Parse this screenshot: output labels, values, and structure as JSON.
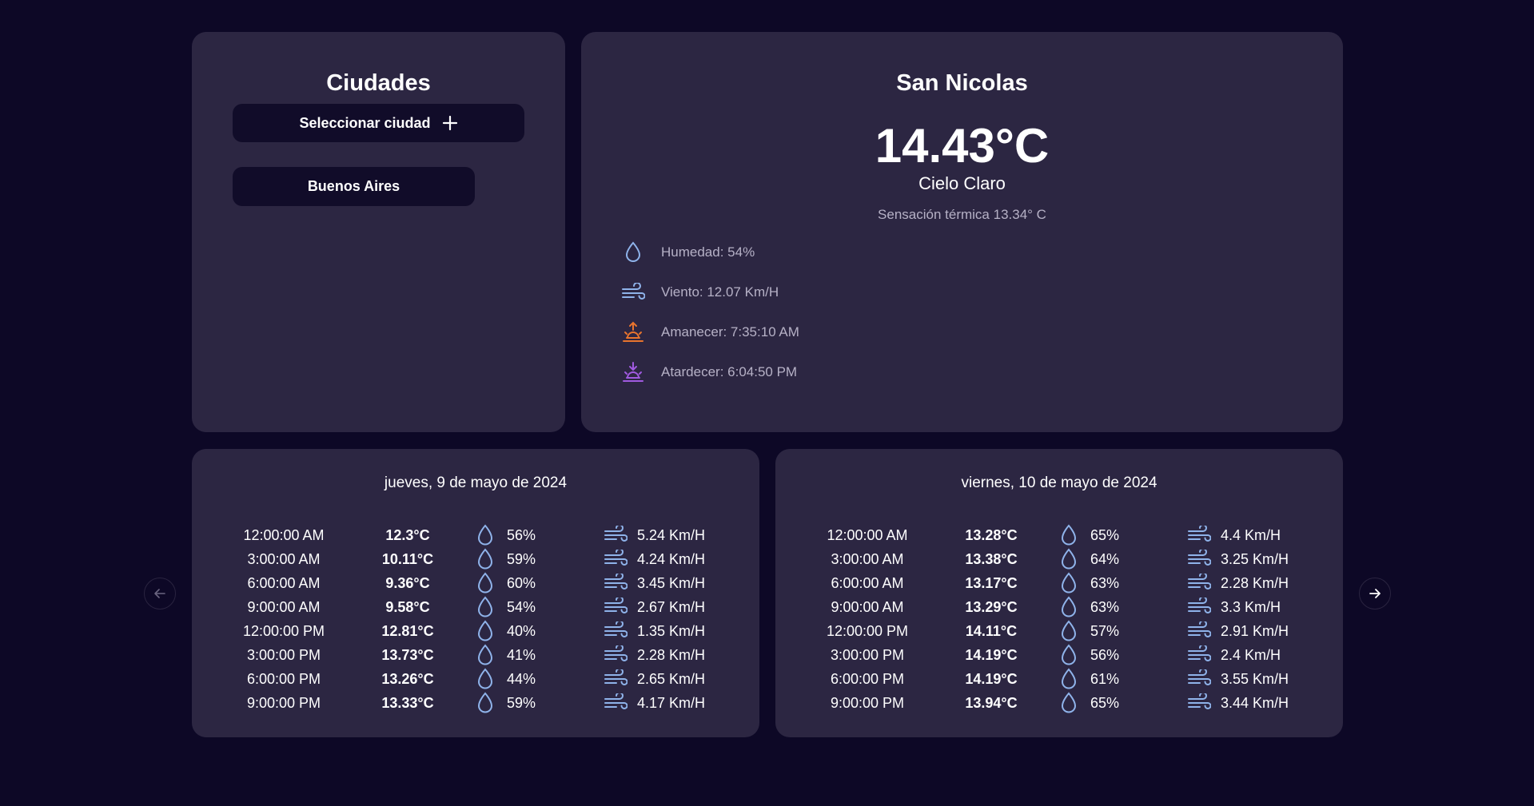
{
  "cities_panel": {
    "title": "Ciudades",
    "select_button_label": "Seleccionar ciudad",
    "cities": [
      "Buenos Aires"
    ]
  },
  "current": {
    "city": "San Nicolas",
    "temperature": "14.43°C",
    "condition": "Cielo Claro",
    "feels_like": "Sensación térmica 13.34° C",
    "details": [
      {
        "icon": "droplet-icon",
        "text": "Humedad: 54%"
      },
      {
        "icon": "wind-icon",
        "text": "Viento: 12.07 Km/H"
      },
      {
        "icon": "sunrise-icon",
        "text": "Amanecer: 7:35:10 AM"
      },
      {
        "icon": "sunset-icon",
        "text": "Atardecer: 6:04:50 PM"
      }
    ]
  },
  "forecast": [
    {
      "date": "jueves, 9 de mayo de 2024",
      "rows": [
        {
          "time": "12:00:00 AM",
          "temp": "12.3°C",
          "humidity": "56%",
          "wind": "5.24 Km/H"
        },
        {
          "time": "3:00:00 AM",
          "temp": "10.11°C",
          "humidity": "59%",
          "wind": "4.24 Km/H"
        },
        {
          "time": "6:00:00 AM",
          "temp": "9.36°C",
          "humidity": "60%",
          "wind": "3.45 Km/H"
        },
        {
          "time": "9:00:00 AM",
          "temp": "9.58°C",
          "humidity": "54%",
          "wind": "2.67 Km/H"
        },
        {
          "time": "12:00:00 PM",
          "temp": "12.81°C",
          "humidity": "40%",
          "wind": "1.35 Km/H"
        },
        {
          "time": "3:00:00 PM",
          "temp": "13.73°C",
          "humidity": "41%",
          "wind": "2.28 Km/H"
        },
        {
          "time": "6:00:00 PM",
          "temp": "13.26°C",
          "humidity": "44%",
          "wind": "2.65 Km/H"
        },
        {
          "time": "9:00:00 PM",
          "temp": "13.33°C",
          "humidity": "59%",
          "wind": "4.17 Km/H"
        }
      ]
    },
    {
      "date": "viernes, 10 de mayo de 2024",
      "rows": [
        {
          "time": "12:00:00 AM",
          "temp": "13.28°C",
          "humidity": "65%",
          "wind": "4.4 Km/H"
        },
        {
          "time": "3:00:00 AM",
          "temp": "13.38°C",
          "humidity": "64%",
          "wind": "3.25 Km/H"
        },
        {
          "time": "6:00:00 AM",
          "temp": "13.17°C",
          "humidity": "63%",
          "wind": "2.28 Km/H"
        },
        {
          "time": "9:00:00 AM",
          "temp": "13.29°C",
          "humidity": "63%",
          "wind": "3.3 Km/H"
        },
        {
          "time": "12:00:00 PM",
          "temp": "14.11°C",
          "humidity": "57%",
          "wind": "2.91 Km/H"
        },
        {
          "time": "3:00:00 PM",
          "temp": "14.19°C",
          "humidity": "56%",
          "wind": "2.4 Km/H"
        },
        {
          "time": "6:00:00 PM",
          "temp": "14.19°C",
          "humidity": "61%",
          "wind": "3.55 Km/H"
        },
        {
          "time": "9:00:00 PM",
          "temp": "13.94°C",
          "humidity": "65%",
          "wind": "3.44 Km/H"
        }
      ]
    }
  ],
  "navigation": {
    "prev_icon": "arrow-left-icon",
    "next_icon": "arrow-right-icon"
  },
  "colors": {
    "background": "#0d0826",
    "card": "#2c2642",
    "button": "#110c29",
    "icon_blue": "#8fb3ea",
    "sunrise": "#e8742e",
    "sunset": "#a05ae0"
  }
}
